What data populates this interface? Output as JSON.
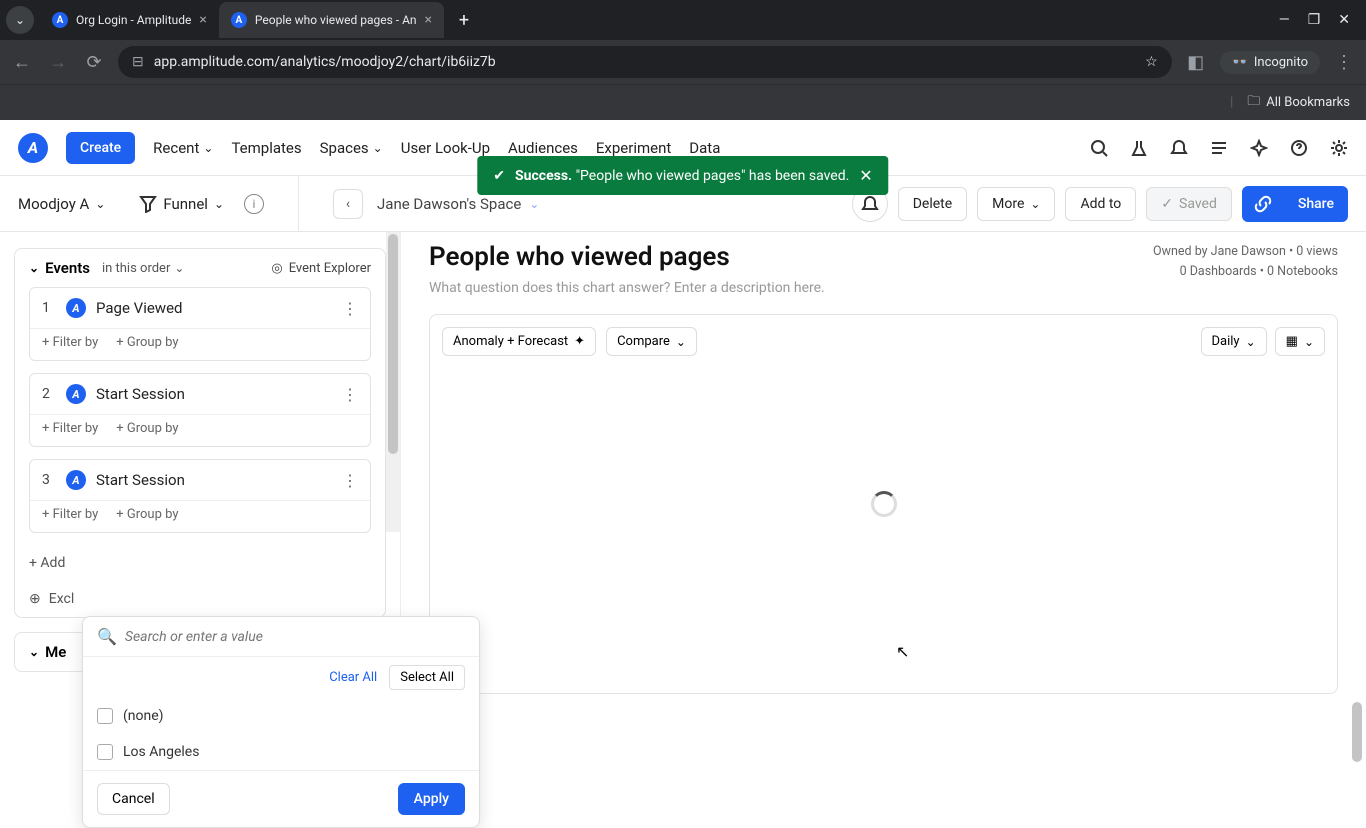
{
  "browser": {
    "tabs": [
      {
        "title": "Org Login - Amplitude",
        "active": false
      },
      {
        "title": "People who viewed pages - An",
        "active": true
      }
    ],
    "url": "app.amplitude.com/analytics/moodjoy2/chart/ib6iiz7b",
    "incognito_label": "Incognito",
    "all_bookmarks": "All Bookmarks"
  },
  "header": {
    "create": "Create",
    "nav": {
      "recent": "Recent",
      "templates": "Templates",
      "spaces": "Spaces",
      "userlookup": "User Look-Up",
      "audiences": "Audiences",
      "experiment": "Experiment",
      "data": "Data"
    }
  },
  "toast": {
    "prefix": "Success.",
    "message": "\"People who viewed pages\" has been saved."
  },
  "subheader": {
    "workspace": "Moodjoy A",
    "chart_type": "Funnel",
    "space": "Jane Dawson's Space",
    "delete": "Delete",
    "more": "More",
    "add_to": "Add to",
    "saved": "Saved",
    "share": "Share"
  },
  "main": {
    "title": "People who viewed pages",
    "desc_placeholder": "What question does this chart answer? Enter a description here.",
    "owner_line": "Owned by Jane Dawson • 0 views",
    "dash_line": "0 Dashboards • 0 Notebooks",
    "toolbar": {
      "anomaly": "Anomaly + Forecast",
      "compare": "Compare",
      "daily": "Daily"
    }
  },
  "events_panel": {
    "title": "Events",
    "order": "in this order",
    "explorer": "Event Explorer",
    "rows": [
      {
        "num": "1",
        "name": "Page Viewed"
      },
      {
        "num": "2",
        "name": "Start Session"
      },
      {
        "num": "3",
        "name": "Start Session"
      }
    ],
    "filter_by": "+ Filter by",
    "group_by": "+ Group by",
    "add_event": "+ Add",
    "exclude": "Excl",
    "measure": "Me"
  },
  "popover": {
    "search_placeholder": "Search or enter a value",
    "clear_all": "Clear All",
    "select_all": "Select All",
    "options": [
      "(none)",
      "Los Angeles"
    ],
    "cancel": "Cancel",
    "apply": "Apply"
  }
}
